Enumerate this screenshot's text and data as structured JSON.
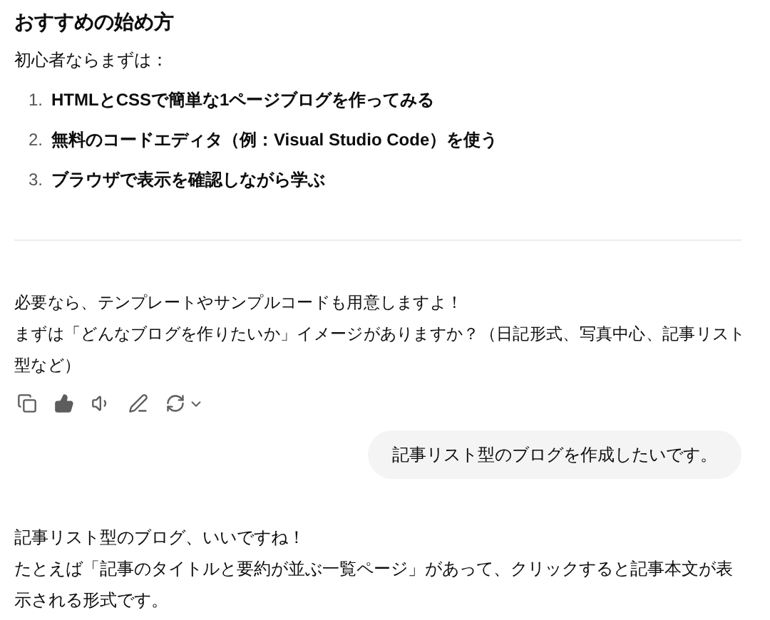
{
  "heading": "おすすめの始め方",
  "intro": "初心者ならまずは：",
  "steps": [
    {
      "number": "1.",
      "text": "HTMLとCSSで簡単な1ページブログを作ってみる"
    },
    {
      "number": "2.",
      "text": "無料のコードエディタ（例：Visual Studio Code）を使う"
    },
    {
      "number": "3.",
      "text": "ブラウザで表示を確認しながら学ぶ"
    }
  ],
  "followup_lines": [
    "必要なら、テンプレートやサンプルコードも用意しますよ！",
    "まずは「どんなブログを作りたいか」イメージがありますか？（日記形式、写真中心、記事リスト型など）"
  ],
  "user_message": "記事リスト型のブログを作成したいです。",
  "reply_lines": [
    "記事リスト型のブログ、いいですね！",
    "たとえば「記事のタイトルと要約が並ぶ一覧ページ」があって、クリックすると記事本文が表示される形式です。"
  ]
}
